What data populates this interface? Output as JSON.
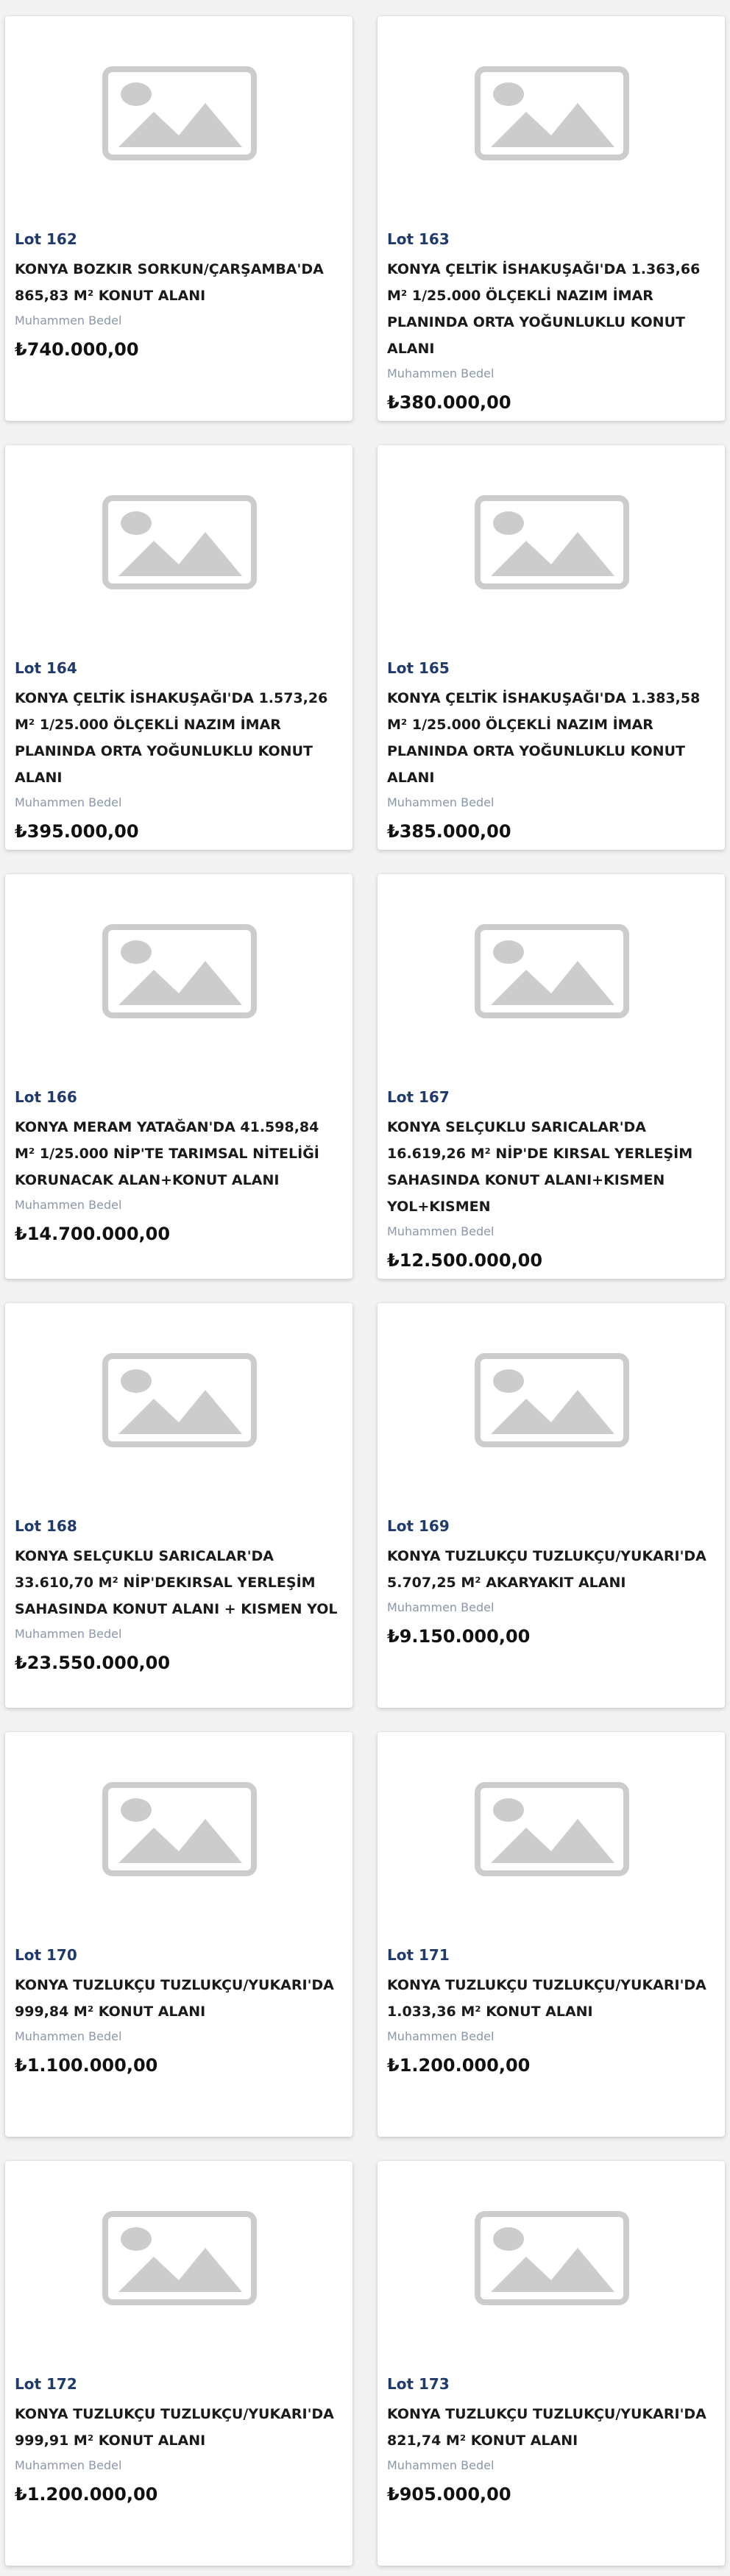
{
  "price_label": "Muhammen Bedel",
  "lots": [
    {
      "lot": "Lot 162",
      "title": "KONYA BOZKIR SORKUN/ÇARŞAMBA'DA 865,83 M² KONUT ALANI",
      "price": "₺740.000,00"
    },
    {
      "lot": "Lot 163",
      "title": "KONYA ÇELTİK İSHAKUŞAĞI'DA 1.363,66 M² 1/25.000 ÖLÇEKLİ NAZIM İMAR PLANINDA ORTA YOĞUNLUKLU KONUT ALANI",
      "price": "₺380.000,00"
    },
    {
      "lot": "Lot 164",
      "title": "KONYA ÇELTİK İSHAKUŞAĞI'DA 1.573,26 M² 1/25.000 ÖLÇEKLİ NAZIM İMAR PLANINDA ORTA YOĞUNLUKLU KONUT ALANI",
      "price": "₺395.000,00"
    },
    {
      "lot": "Lot 165",
      "title": "KONYA ÇELTİK İSHAKUŞAĞI'DA 1.383,58 M² 1/25.000 ÖLÇEKLİ NAZIM İMAR PLANINDA ORTA YOĞUNLUKLU KONUT ALANI",
      "price": "₺385.000,00"
    },
    {
      "lot": "Lot 166",
      "title": "KONYA MERAM YATAĞAN'DA 41.598,84 M² 1/25.000 NİP'TE TARIMSAL NİTELİĞİ KORUNACAK ALAN+KONUT ALANI",
      "price": "₺14.700.000,00"
    },
    {
      "lot": "Lot 167",
      "title": "KONYA SELÇUKLU SARICALAR'DA 16.619,26 M² NİP'DE KIRSAL YERLEŞİM SAHASINDA KONUT ALANI+KISMEN YOL+KISMEN",
      "price": "₺12.500.000,00"
    },
    {
      "lot": "Lot 168",
      "title": "KONYA SELÇUKLU SARICALAR'DA 33.610,70 M² NİP'DEKIRSAL YERLEŞİM SAHASINDA KONUT ALANI + KISMEN YOL",
      "price": "₺23.550.000,00"
    },
    {
      "lot": "Lot 169",
      "title": "KONYA TUZLUKÇU TUZLUKÇU/YUKARI'DA 5.707,25 M² AKARYAKIT ALANI",
      "price": "₺9.150.000,00"
    },
    {
      "lot": "Lot 170",
      "title": "KONYA TUZLUKÇU TUZLUKÇU/YUKARI'DA 999,84 M² KONUT ALANI",
      "price": "₺1.100.000,00"
    },
    {
      "lot": "Lot 171",
      "title": "KONYA TUZLUKÇU TUZLUKÇU/YUKARI'DA 1.033,36 M² KONUT ALANI",
      "price": "₺1.200.000,00"
    },
    {
      "lot": "Lot 172",
      "title": "KONYA TUZLUKÇU TUZLUKÇU/YUKARI'DA 999,91 M² KONUT ALANI",
      "price": "₺1.200.000,00"
    },
    {
      "lot": "Lot 173",
      "title": "KONYA TUZLUKÇU TUZLUKÇU/YUKARI'DA 821,74 M² KONUT ALANI",
      "price": "₺905.000,00"
    }
  ]
}
